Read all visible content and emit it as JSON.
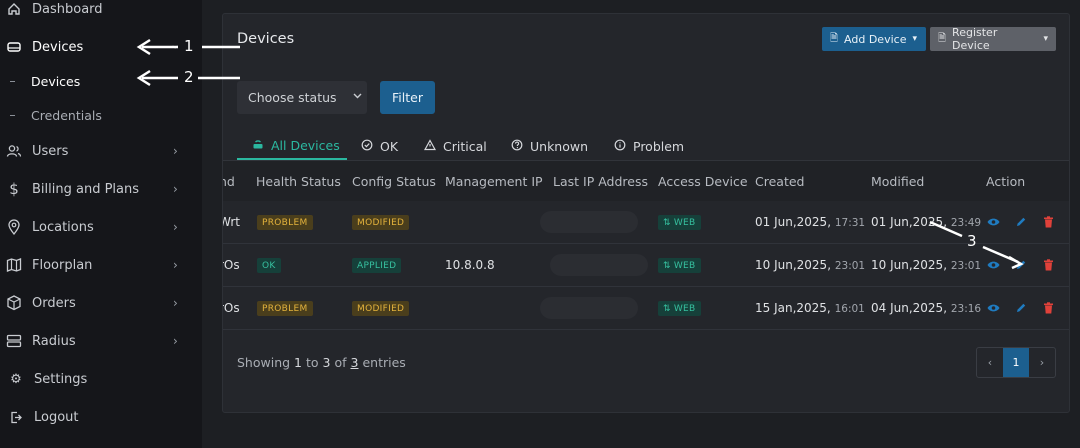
{
  "sidebar": {
    "items": [
      {
        "label": "Dashboard",
        "icon": "home-icon"
      },
      {
        "label": "Devices",
        "icon": "device-icon"
      },
      {
        "label": "Users",
        "icon": "users-icon"
      },
      {
        "label": "Billing and Plans",
        "icon": "dollar-icon"
      },
      {
        "label": "Locations",
        "icon": "location-pin-icon"
      },
      {
        "label": "Floorplan",
        "icon": "map-icon"
      },
      {
        "label": "Orders",
        "icon": "box-icon"
      },
      {
        "label": "Radius",
        "icon": "server-icon"
      },
      {
        "label": "Settings",
        "icon": "gear-icon"
      },
      {
        "label": "Logout",
        "icon": "logout-icon"
      }
    ],
    "sub_items": [
      {
        "label": "Devices"
      },
      {
        "label": "Credentials"
      }
    ]
  },
  "card": {
    "title": "Devices",
    "add_device_label": "Add Device",
    "register_device_label": "Register Device",
    "status_placeholder": "Choose status",
    "filter_label": "Filter"
  },
  "tabs": [
    {
      "label": "All Devices",
      "icon": "router-icon"
    },
    {
      "label": "OK",
      "icon": "check-circle-icon"
    },
    {
      "label": "Critical",
      "icon": "warning-icon"
    },
    {
      "label": "Unknown",
      "icon": "question-icon"
    },
    {
      "label": "Problem",
      "icon": "info-icon"
    }
  ],
  "table": {
    "headers": [
      "nd",
      "Health Status",
      "Config Status",
      "Management IP",
      "Last IP Address",
      "Access Device",
      "Created",
      "Modified",
      "Action"
    ],
    "rows": [
      {
        "name": "Wrt",
        "health": "PROBLEM",
        "config": "MODIFIED",
        "mgmt_ip": "",
        "access": "WEB",
        "created_date": "01 Jun,2025,",
        "created_time": "17:31",
        "modified_date": "01 Jun,2025,",
        "modified_time": "23:49"
      },
      {
        "name": "rOs",
        "health": "OK",
        "config": "APPLIED",
        "mgmt_ip": "10.8.0.8",
        "access": "WEB",
        "created_date": "10 Jun,2025,",
        "created_time": "23:01",
        "modified_date": "10 Jun,2025,",
        "modified_time": "23:01"
      },
      {
        "name": "rOs",
        "health": "PROBLEM",
        "config": "MODIFIED",
        "mgmt_ip": "",
        "access": "WEB",
        "created_date": "15 Jan,2025,",
        "created_time": "16:01",
        "modified_date": "04 Jun,2025,",
        "modified_time": "23:16"
      }
    ]
  },
  "footer": {
    "showing_prefix": "Showing",
    "from": "1",
    "to_word": "to",
    "to": "3",
    "of_word": "of",
    "total": "3",
    "entries_word": "entries",
    "prev": "‹",
    "page": "1",
    "next": "›"
  },
  "annotations": {
    "a1": "1",
    "a2": "2",
    "a3": "3"
  },
  "colors": {
    "accent": "#1c5f8f",
    "teal": "#2bb8a0",
    "warning": "#e3b23c",
    "danger": "#e0413a"
  }
}
